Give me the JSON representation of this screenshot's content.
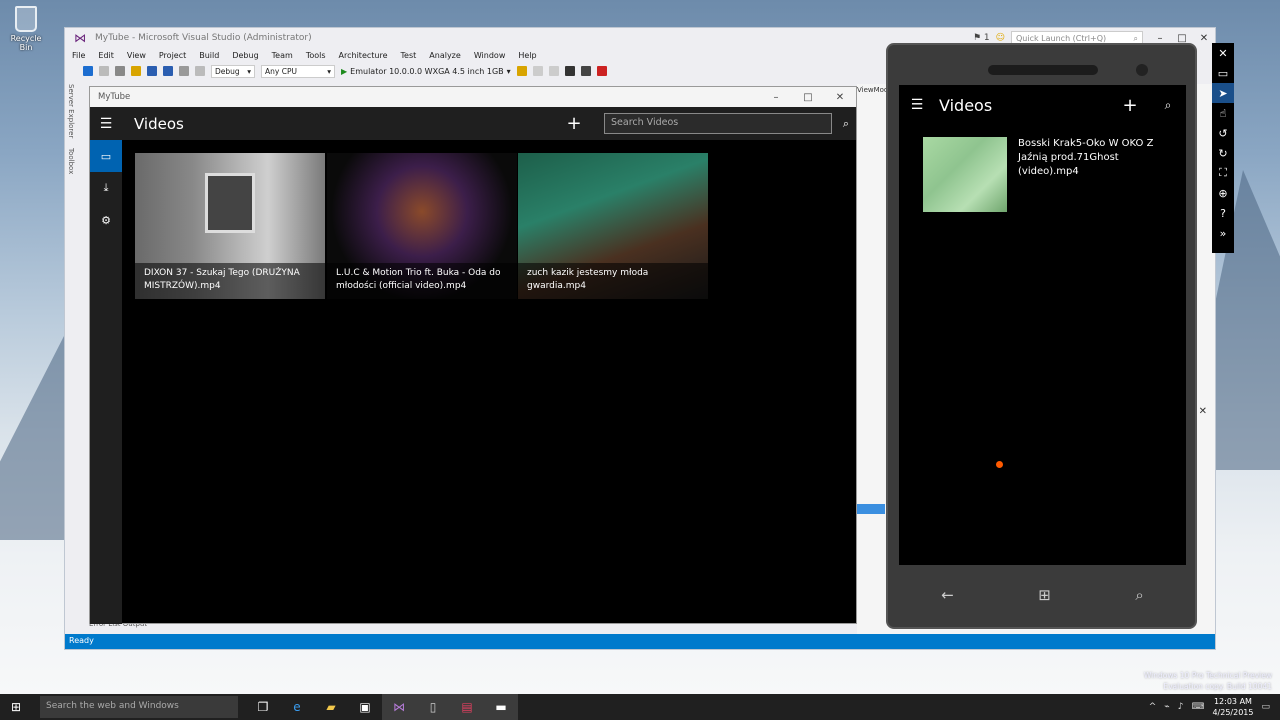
{
  "desktop": {
    "recycle_label": "Recycle Bin"
  },
  "vs": {
    "title": "MyTube - Microsoft Visual Studio (Administrator)",
    "notif_count": "1",
    "quick_launch": "Quick Launch (Ctrl+Q)",
    "menu": [
      "File",
      "Edit",
      "View",
      "Project",
      "Build",
      "Debug",
      "Team",
      "Tools",
      "Architecture",
      "Test",
      "Analyze",
      "Window",
      "Help"
    ],
    "config": "Debug",
    "platform": "Any CPU",
    "run_target": "Emulator 10.0.0.0 WXGA 4.5 inch 1GB",
    "side_tabs": [
      "Server Explorer",
      "Toolbox"
    ],
    "bottom_tabs": "Error List   Output",
    "status": "Ready",
    "right_fragment": "ViewMod"
  },
  "app": {
    "window_title": "MyTube",
    "header_title": "Videos",
    "search_placeholder": "Search Videos",
    "videos": [
      {
        "title": "DIXON 37 - Szukaj Tego (DRUŻYNA MISTRZÓW).mp4"
      },
      {
        "title": "L.U.C & Motion Trio ft. Buka - Oda do młodości (official video).mp4"
      },
      {
        "title": "zuch kazik   jestesmy młoda gwardia.mp4"
      }
    ]
  },
  "phone": {
    "header_title": "Videos",
    "item_title": "Bosski Krak5-Oko W OKO Z Jaźnią prod.71Ghost (video).mp4"
  },
  "taskbar": {
    "search_placeholder": "Search the web and Windows",
    "time": "12:03 AM",
    "date": "4/25/2015"
  },
  "watermark": {
    "line1": "Windows 10 Pro Technical Preview",
    "line2": "Evaluation copy. Build 10041"
  }
}
